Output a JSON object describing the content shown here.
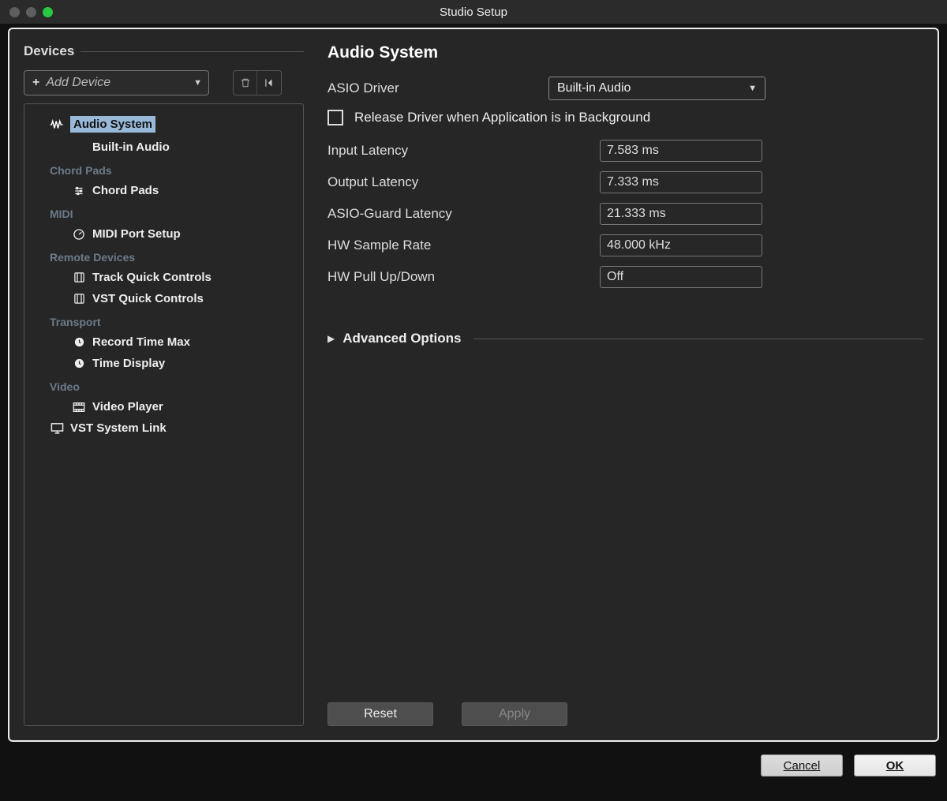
{
  "titlebar": {
    "title": "Studio Setup"
  },
  "sidebar": {
    "header": "Devices",
    "add_device_button": "Add Device",
    "groups": [
      {
        "name_top_items": [
          {
            "label": "Audio System",
            "icon": "waveform-icon",
            "selected": true
          },
          {
            "label": "Built-in Audio",
            "icon": "",
            "selected": false
          }
        ]
      },
      {
        "header": "Chord Pads",
        "items": [
          {
            "label": "Chord Pads",
            "icon": "sliders-icon"
          }
        ]
      },
      {
        "header": "MIDI",
        "items": [
          {
            "label": "MIDI Port Setup",
            "icon": "gauge-icon"
          }
        ]
      },
      {
        "header": "Remote Devices",
        "items": [
          {
            "label": "Track Quick Controls",
            "icon": "grid-icon"
          },
          {
            "label": "VST Quick Controls",
            "icon": "grid-icon"
          }
        ]
      },
      {
        "header": "Transport",
        "items": [
          {
            "label": "Record Time Max",
            "icon": "clock-icon"
          },
          {
            "label": "Time Display",
            "icon": "clock-icon"
          }
        ]
      },
      {
        "header": "Video",
        "items": [
          {
            "label": "Video Player",
            "icon": "film-icon"
          }
        ]
      }
    ],
    "bottom_item": {
      "label": "VST System Link",
      "icon": "monitor-icon"
    }
  },
  "main": {
    "title": "Audio System",
    "asio_driver_label": "ASIO Driver",
    "asio_driver_value": "Built-in Audio",
    "release_driver_label": "Release Driver when Application is in Background",
    "release_driver_checked": false,
    "rows": [
      {
        "label": "Input Latency",
        "value": "7.583 ms"
      },
      {
        "label": "Output Latency",
        "value": "7.333 ms"
      },
      {
        "label": "ASIO-Guard Latency",
        "value": "21.333 ms"
      },
      {
        "label": "HW Sample Rate",
        "value": "48.000 kHz"
      },
      {
        "label": "HW Pull Up/Down",
        "value": "Off"
      }
    ],
    "advanced_label": "Advanced Options",
    "reset_button": "Reset",
    "apply_button": "Apply"
  },
  "footer": {
    "cancel": "Cancel",
    "ok": "OK"
  }
}
